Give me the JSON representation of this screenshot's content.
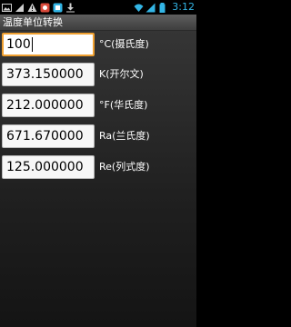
{
  "status_bar": {
    "left_icons": [
      "image-icon",
      "notification-icon",
      "warning-icon",
      "app-icon",
      "app-icon-2",
      "download-icon"
    ],
    "right_icons": [
      "signal-icon",
      "wifi-icon",
      "battery-icon"
    ],
    "time": "3:12"
  },
  "app": {
    "title": "温度单位转换"
  },
  "rows": [
    {
      "value": "100",
      "unit": "°C(摄氏度)"
    },
    {
      "value": "373.150000",
      "unit": "K(开尔文)"
    },
    {
      "value": "212.000000",
      "unit": "°F(华氏度)"
    },
    {
      "value": "671.670000",
      "unit": "Ra(兰氏度)"
    },
    {
      "value": "125.000000",
      "unit": "Re(列式度)"
    }
  ],
  "colors": {
    "status_accent": "#33b5e5",
    "focus_border": "#f0a030",
    "background": "#202020"
  }
}
